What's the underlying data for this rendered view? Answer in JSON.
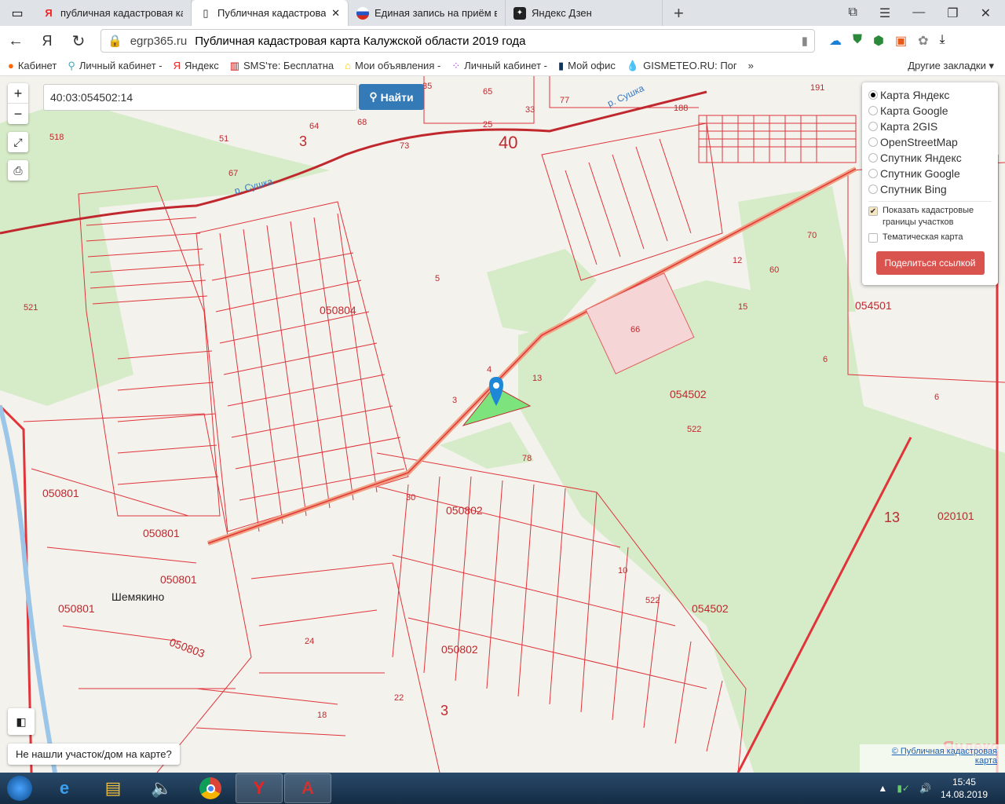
{
  "browser": {
    "tabs": [
      {
        "label": "публичная кадастровая ка",
        "icon": "yandex-icon",
        "active": false
      },
      {
        "label": "Публичная кадастровая",
        "icon": "document-icon",
        "active": true
      },
      {
        "label": "Единая запись на приём в",
        "icon": "russia-flag-icon",
        "active": false
      },
      {
        "label": "Яндекс Дзен",
        "icon": "zen-icon",
        "active": false
      }
    ],
    "close_glyph": "✕",
    "new_tab": "+",
    "url_host": "egrp365.ru",
    "url_title": "Публичная кадастровая карта Калужской области 2019 года",
    "bookmarks": [
      "Кабинет",
      "Личный кабинет -",
      "Яндекс",
      "SMS'те: Бесплатна",
      "Мои объявления -",
      "Личный кабинет -",
      "Мой офис",
      "GISMETEO.RU: Пог"
    ],
    "more_bookmarks": "»",
    "other_bookmarks": "Другие закладки ▾"
  },
  "map": {
    "search_value": "40:03:054502:14",
    "find_label": "Найти",
    "zoom_in": "+",
    "zoom_out": "−",
    "layers": [
      "Карта Яндекс",
      "Карта Google",
      "Карта 2GIS",
      "OpenStreetMap",
      "Спутник Яндекс",
      "Спутник Google",
      "Спутник Bing"
    ],
    "selected_layer": "Карта Яндекс",
    "show_borders_label": "Показать кадастровые границы участков",
    "show_borders_checked": true,
    "thematic_label": "Тематическая карта",
    "thematic_checked": false,
    "share_label": "Поделиться ссылкой",
    "not_found": "Не нашли участок/дом на карте?",
    "copyright": "© Публичная кадастровая карта",
    "yandex_logo": "Яндекс",
    "labels": [
      "050804",
      "054502",
      "050802",
      "054501",
      "050801",
      "050801",
      "050801",
      "050801",
      "050803",
      "050802",
      "054502",
      "020101",
      "40",
      "3",
      "3",
      "13",
      "Шемякино",
      "р. Сушка",
      "р. Сушка",
      "522",
      "522",
      "5",
      "521",
      "66",
      "13",
      "78",
      "4",
      "3",
      "191",
      "188",
      "70",
      "60",
      "12",
      "15",
      "6",
      "6",
      "10",
      "24",
      "22",
      "18",
      "35",
      "30",
      "65",
      "77",
      "33",
      "25",
      "73",
      "68",
      "64",
      "51",
      "67",
      "518"
    ]
  },
  "taskbar": {
    "time": "15:45",
    "date": "14.08.2019"
  }
}
